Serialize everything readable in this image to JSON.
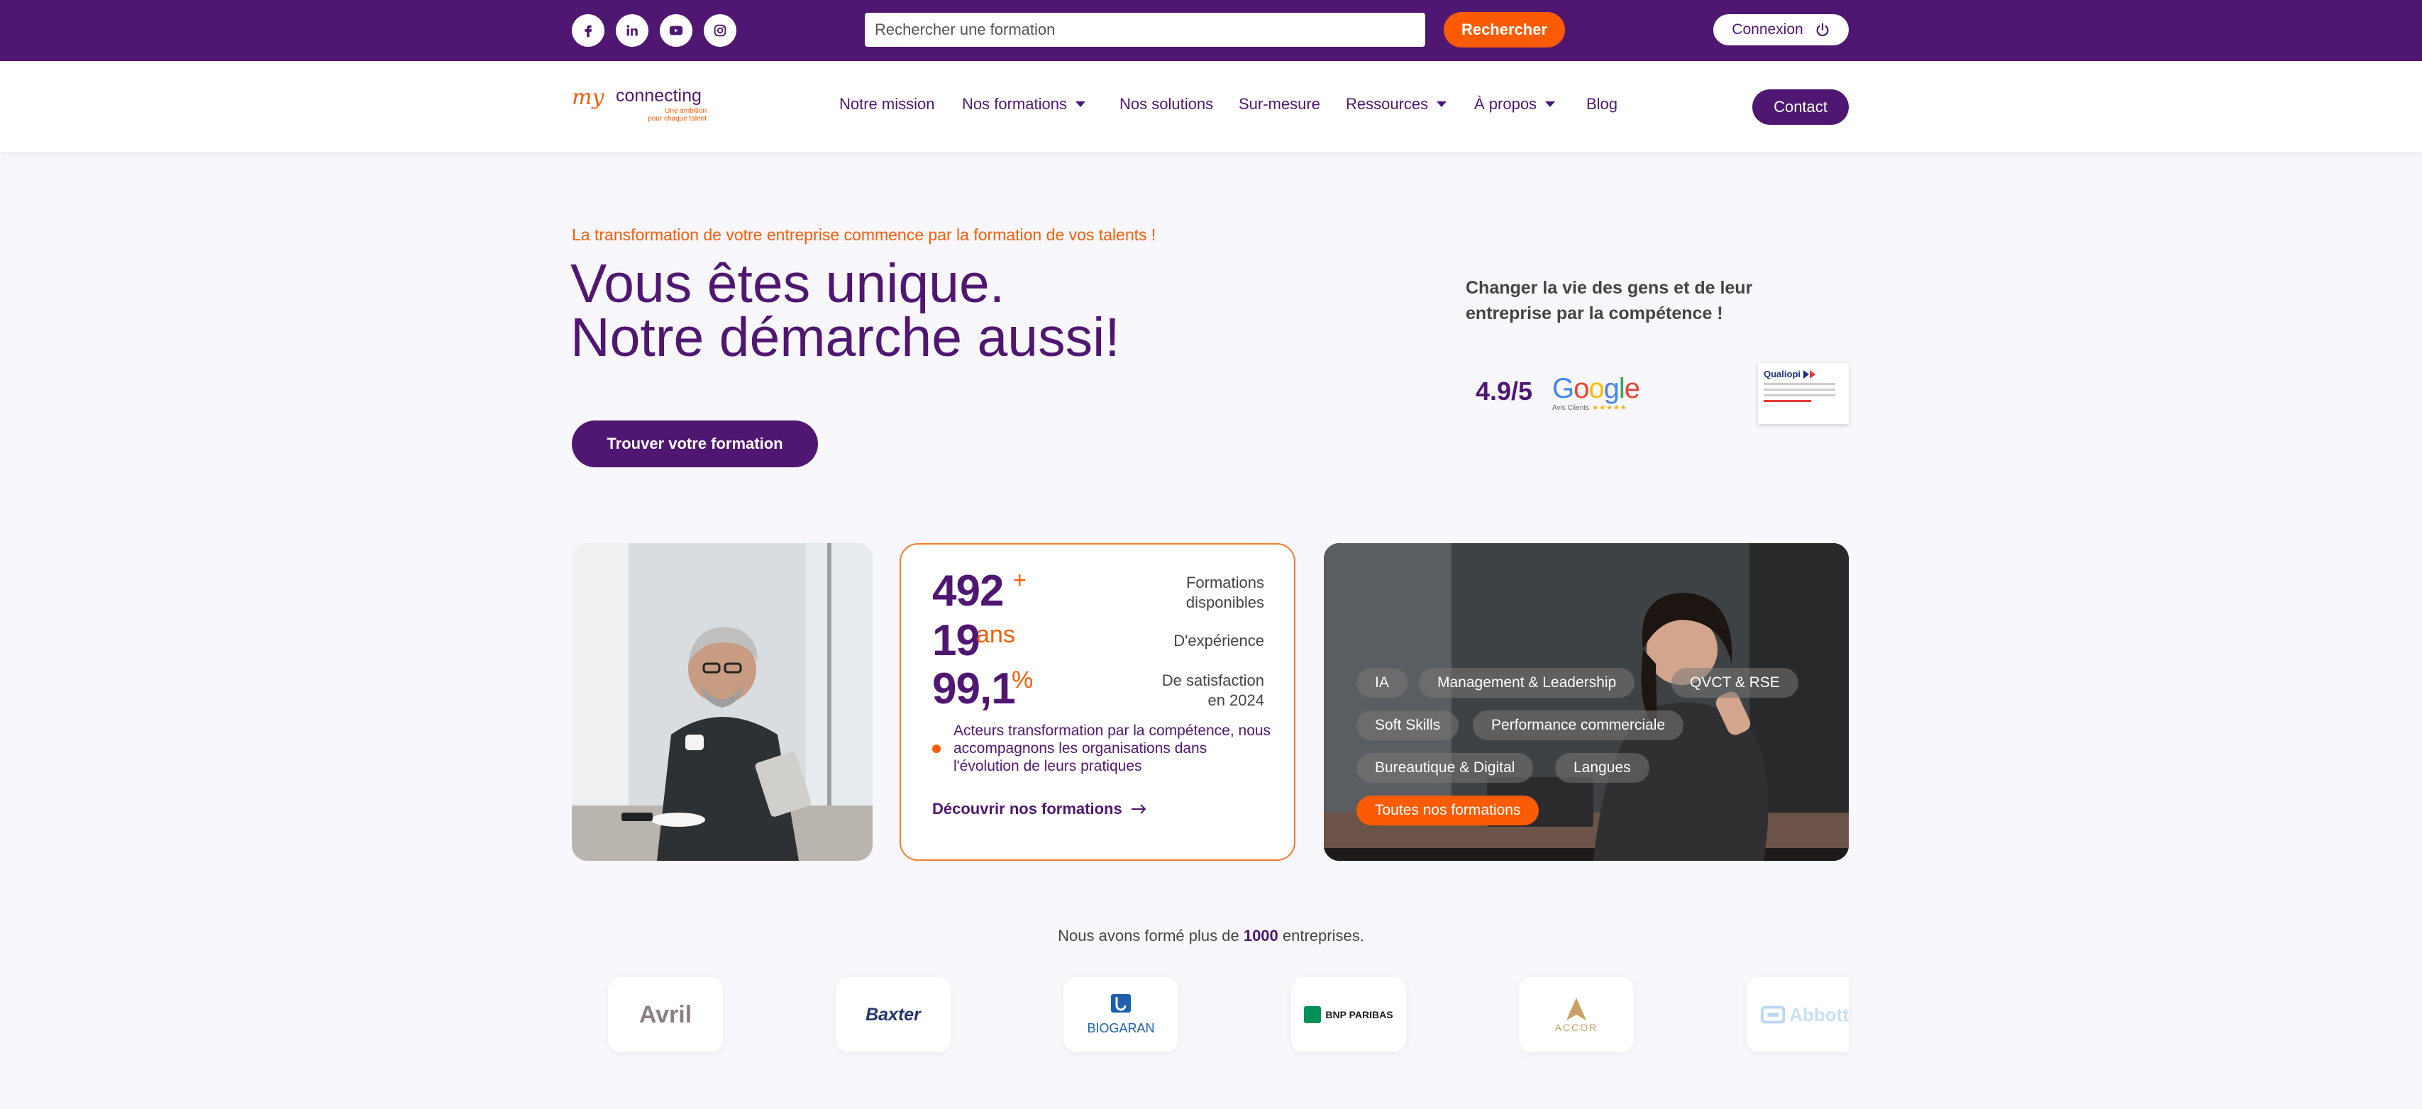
{
  "topbar": {
    "social": [
      "facebook-icon",
      "linkedin-icon",
      "youtube-icon",
      "instagram-icon"
    ],
    "search_placeholder": "Rechercher une formation",
    "search_button": "Rechercher",
    "login_label": "Connexion"
  },
  "header": {
    "logo": {
      "my": "my",
      "connecting": "connecting",
      "tagline_1": "Une ambition",
      "tagline_2": "pour chaque talent"
    },
    "nav": [
      {
        "label": "Notre mission",
        "dropdown": false
      },
      {
        "label": "Nos formations",
        "dropdown": true
      },
      {
        "label": "Nos solutions",
        "dropdown": false
      },
      {
        "label": "Sur-mesure",
        "dropdown": false
      },
      {
        "label": "Ressources",
        "dropdown": true
      },
      {
        "label": "À propos",
        "dropdown": true
      },
      {
        "label": "Blog",
        "dropdown": false
      }
    ],
    "contact_button": "Contact"
  },
  "hero": {
    "eyebrow": "La transformation de votre entreprise commence par la formation de vos talents !",
    "title_line_1": "Vous êtes unique.",
    "title_line_2": "Notre démarche aussi!",
    "cta": "Trouver votre formation",
    "tagline": "Changer la vie des gens et de leur entreprise par la compétence !",
    "rating": "4.9/5",
    "google": {
      "word": "Google",
      "sub": "Avis Clients",
      "stars": "★★★★★"
    },
    "qualiopi": {
      "title": "Qualiopi"
    }
  },
  "stats": {
    "items": [
      {
        "value": "492",
        "suffix": "+",
        "label_1": "Formations",
        "label_2": "disponibles"
      },
      {
        "value": "19",
        "suffix": "ans",
        "label_1": "D'expérience",
        "label_2": ""
      },
      {
        "value": "99,1",
        "suffix": "%",
        "label_1": "De satisfaction",
        "label_2": "en 2024"
      }
    ],
    "note": "Acteurs transformation par la compétence, nous accompagnons les organisations dans l'évolution de leurs pratiques",
    "link": "Découvrir nos formations"
  },
  "topics": {
    "chips": [
      "IA",
      "Management & Leadership",
      "QVCT & RSE",
      "Soft Skills",
      "Performance commerciale",
      "Bureautique & Digital",
      "Langues"
    ],
    "all_button": "Toutes nos formations"
  },
  "clients": {
    "text_before": "Nous avons formé plus de",
    "count": "1000",
    "text_after": "entreprises.",
    "logos": [
      "Avril",
      "Baxter",
      "BIOGARAN",
      "BNP PARIBAS",
      "ACCOR",
      "Abbott"
    ]
  },
  "colors": {
    "brand_purple": "#4f1771",
    "accent_orange": "#fb5b05"
  }
}
